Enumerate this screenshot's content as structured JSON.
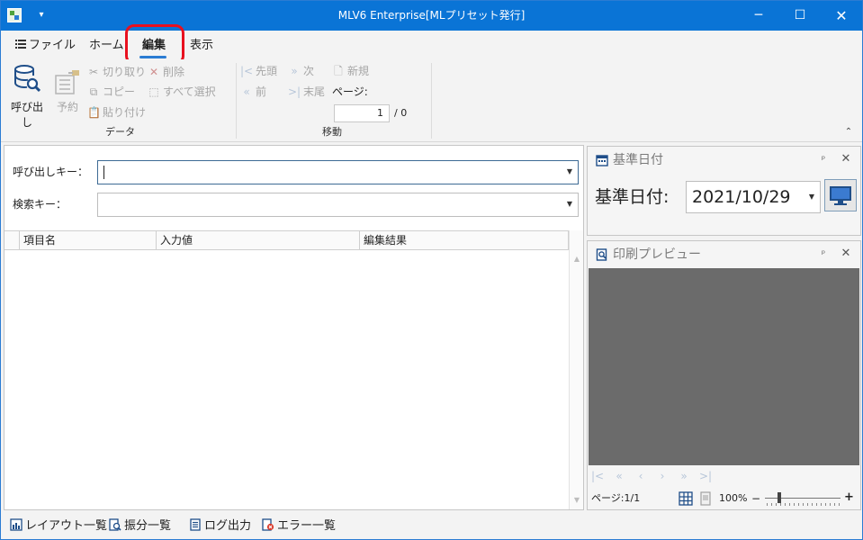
{
  "window": {
    "title": "MLV6 Enterprise[MLプリセット発行]",
    "qat_glyph": "▾",
    "min_glyph": "─",
    "max_glyph": "☐",
    "close_glyph": "✕"
  },
  "ribbon_tabs": {
    "file": "ファイル",
    "home": "ホーム",
    "edit": "編集",
    "view": "表示",
    "active": "編集"
  },
  "ribbon": {
    "data_group": {
      "label": "データ",
      "call_label": "呼び出し",
      "reserve_label": "予約",
      "cut_label": "切り取り",
      "delete_label": "削除",
      "copy_label": "コピー",
      "select_all_label": "すべて選択",
      "paste_label": "貼り付け"
    },
    "move_group": {
      "label": "移動",
      "first_label": "先頭",
      "next_label": "次",
      "new_label": "新規",
      "prev_label": "前",
      "last_label": "末尾",
      "page_label": "ページ:",
      "page_value": "1",
      "page_total": "/ 0"
    },
    "collapse_glyph": "⌃"
  },
  "form": {
    "call_key_label": "呼び出しキー：",
    "call_key_value": "",
    "search_key_label": "検索キー：",
    "search_key_value": ""
  },
  "grid": {
    "columns": [
      "項目名",
      "入力値",
      "編集結果"
    ]
  },
  "base_date_panel": {
    "title": "基準日付",
    "label": "基準日付:",
    "value": "2021/10/29",
    "pin_glyph": "ᵖ",
    "close_glyph": "✕"
  },
  "preview_panel": {
    "title": "印刷プレビュー",
    "pin_glyph": "ᵖ",
    "close_glyph": "✕",
    "nav": {
      "first": "|<",
      "prev_fast": "«",
      "prev": "‹",
      "next": "›",
      "next_fast": "»",
      "last": ">|"
    },
    "page_status": "ページ:1/1",
    "zoom": "100%",
    "zoom_minus": "−",
    "zoom_plus": "+"
  },
  "bottom_bar": {
    "layout_list": "レイアウト一覧",
    "sort_list": "振分一覧",
    "log_output": "ログ出力",
    "error_list": "エラー一覧"
  },
  "colors": {
    "titlebar": "#0a74d6",
    "accent": "#2b7cd3",
    "highlight_box": "#e8101e",
    "preview_bg": "#6b6b6b"
  }
}
